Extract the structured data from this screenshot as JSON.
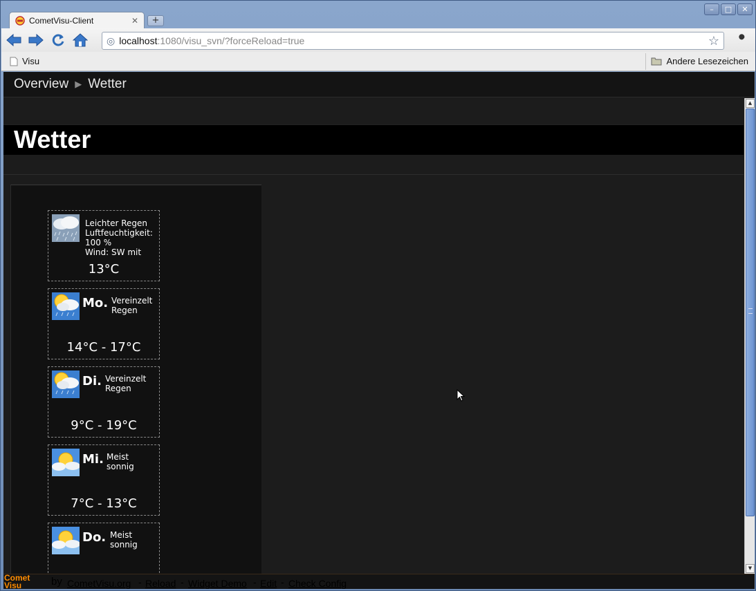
{
  "browser": {
    "tab_title": "CometVisu-Client",
    "url_host": "localhost",
    "url_rest": ":1080/visu_svn/?forceReload=true",
    "bookmark_visu": "Visu",
    "bookmark_other": "Andere Lesezeichen"
  },
  "nav": {
    "breadcrumb_root": "Overview",
    "breadcrumb_current": "Wetter"
  },
  "page": {
    "title": "Wetter"
  },
  "weather": {
    "current": {
      "line1": "Leichter Regen",
      "line2": "Luftfeuchtigkeit:",
      "line3": "100 %",
      "line4": "Wind: SW mit",
      "temp": "13°C",
      "icon": "rain-cloud-icon"
    },
    "forecast": [
      {
        "day": "Mo.",
        "cond1": "Vereinzelt",
        "cond2": "Regen",
        "temp": "14°C - 17°C",
        "icon": "sun-cloud-rain-icon"
      },
      {
        "day": "Di.",
        "cond1": "Vereinzelt",
        "cond2": "Regen",
        "temp": "9°C - 19°C",
        "icon": "sun-cloud-rain-icon"
      },
      {
        "day": "Mi.",
        "cond1": "Meist",
        "cond2": "sonnig",
        "temp": "7°C - 13°C",
        "icon": "sun-cloud-icon"
      },
      {
        "day": "Do.",
        "cond1": "Meist",
        "cond2": "sonnig",
        "temp": "",
        "icon": "sun-cloud-icon"
      }
    ]
  },
  "footer": {
    "logo_line1": "Comet",
    "logo_line2": "Visu",
    "by": "by",
    "links": [
      "CometVisu.org",
      "Reload",
      "Widget Demo",
      "Edit",
      "Check Config"
    ],
    "separator": "-"
  },
  "colors": {
    "background": "#1c1c1c",
    "title_bar": "#000000",
    "accent": "#ff8c00"
  }
}
